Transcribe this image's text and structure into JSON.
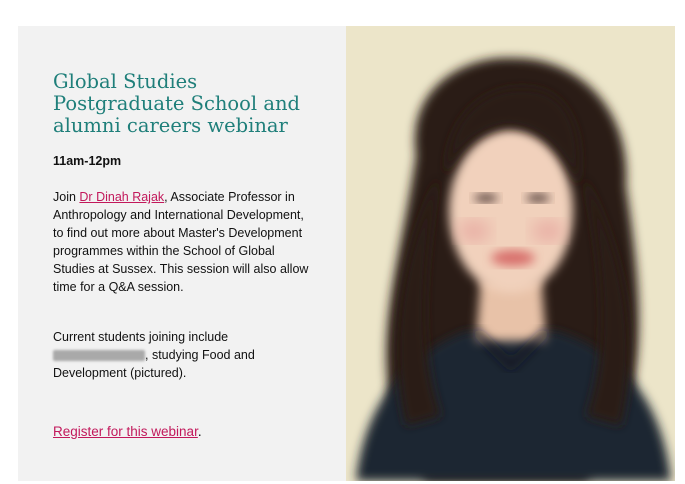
{
  "event": {
    "title": "Global Studies Postgraduate School and alumni careers webinar",
    "time": "11am-12pm",
    "description_prefix": "Join ",
    "speaker_link": "Dr Dinah Rajak",
    "description_suffix": ", Associate Professor in Anthropology and International Development, to find out more about Master's Development programmes within the School of Global Studies at Sussex. This session will also allow time for a Q&A session.",
    "students_intro": "Current students joining include",
    "students_suffix": ", studying Food and Development (pictured).",
    "register_link": "Register for this webinar",
    "register_suffix": "."
  },
  "colors": {
    "title": "#1f7f7a",
    "link": "#c2185b",
    "panel": "#f2f2f2",
    "photo_bg": "#ece5c9"
  }
}
